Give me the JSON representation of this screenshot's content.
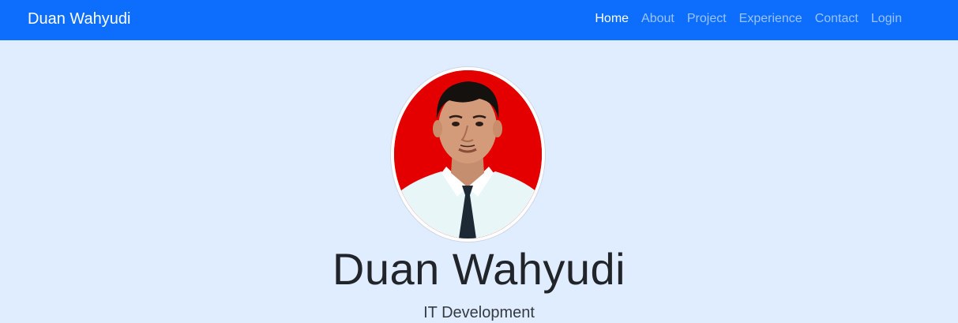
{
  "navbar": {
    "brand": "Duan Wahyudi",
    "items": [
      {
        "label": "Home",
        "active": true
      },
      {
        "label": "About",
        "active": false
      },
      {
        "label": "Project",
        "active": false
      },
      {
        "label": "Experience",
        "active": false
      },
      {
        "label": "Contact",
        "active": false
      },
      {
        "label": "Login",
        "active": false
      }
    ]
  },
  "hero": {
    "name": "Duan Wahyudi",
    "role": "IT Development"
  },
  "colors": {
    "navbar_bg": "#0d6efd",
    "page_bg": "#e0ecff",
    "photo_bg": "#e50000"
  }
}
